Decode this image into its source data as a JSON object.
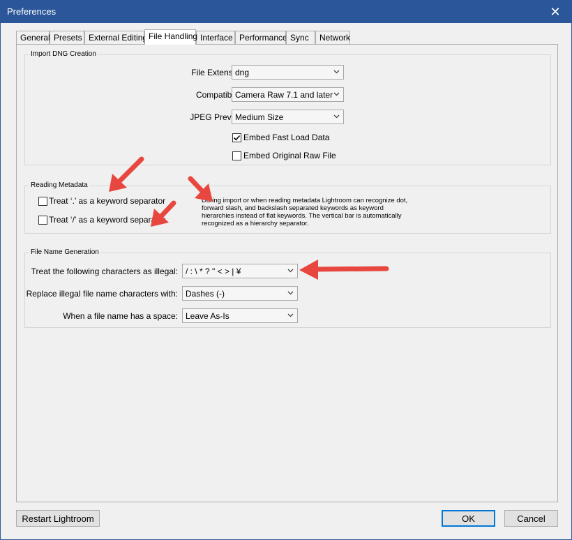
{
  "window": {
    "title": "Preferences",
    "close_symbol": "✕"
  },
  "tabs": [
    {
      "label": "General"
    },
    {
      "label": "Presets"
    },
    {
      "label": "External Editing"
    },
    {
      "label": "File Handling",
      "active": true
    },
    {
      "label": "Interface"
    },
    {
      "label": "Performance"
    },
    {
      "label": "Sync"
    },
    {
      "label": "Network"
    }
  ],
  "import_dng": {
    "title": "Import DNG Creation",
    "file_extension": {
      "label": "File Extension:",
      "value": "dng"
    },
    "compatibility": {
      "label": "Compatibility:",
      "value": "Camera Raw 7.1 and later"
    },
    "jpeg_preview": {
      "label": "JPEG Preview:",
      "value": "Medium Size"
    },
    "embed_fast_load": {
      "label": "Embed Fast Load Data",
      "checked": true
    },
    "embed_original_raw": {
      "label": "Embed Original Raw File",
      "checked": false
    }
  },
  "reading_metadata": {
    "title": "Reading Metadata",
    "dot_separator": {
      "label": "Treat ‘.’ as a keyword separator",
      "checked": false
    },
    "slash_separator": {
      "label": "Treat ‘/’ as a keyword separator",
      "checked": false
    },
    "help_lines": [
      "During import or when reading metadata Lightroom can recognize dot,",
      "forward slash, and backslash separated keywords as keyword",
      "hierarchies instead of flat keywords. The vertical bar is automatically",
      "recognized as a hierarchy separator."
    ]
  },
  "file_name_generation": {
    "title": "File Name Generation",
    "illegal_chars": {
      "label": "Treat the following characters as illegal:",
      "value": "/ : \\ * ? \" < > | ¥"
    },
    "replace_with": {
      "label": "Replace illegal file name characters with:",
      "value": "Dashes (-)"
    },
    "space_handling": {
      "label": "When a file name has a space:",
      "value": "Leave As-Is"
    }
  },
  "buttons": {
    "restart": "Restart Lightroom",
    "ok": "OK",
    "cancel": "Cancel"
  },
  "annotations": {
    "arrow_color": "#e8473f"
  },
  "colors": {
    "titlebar": "#2b579a",
    "dialog_bg": "#f0f0f0",
    "focus_border": "#0078d7"
  }
}
